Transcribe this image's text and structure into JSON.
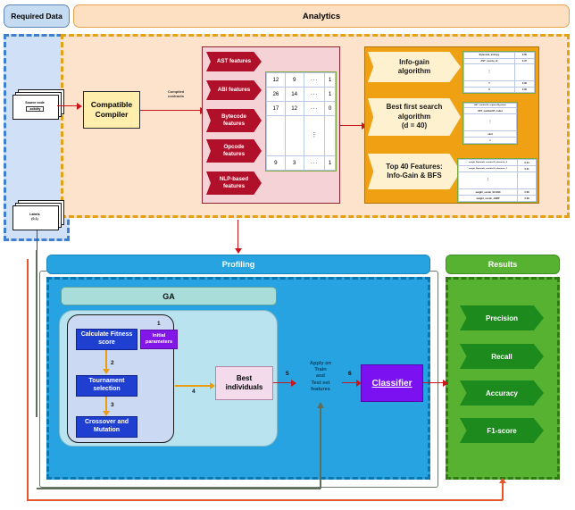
{
  "headers": {
    "required_data": "Required Data",
    "analytics": "Analytics",
    "profiling": "Profiling",
    "results": "Results",
    "ga": "GA"
  },
  "required_data": {
    "source_doc": {
      "title": "Source code",
      "sub": ".solidity"
    },
    "labels_doc": {
      "title": "Labels",
      "sub": "(0,1)"
    }
  },
  "analytics": {
    "compiler": "Compatible\nCompiler",
    "compiler_line1": "Compatible",
    "compiler_line2": "Compiler",
    "edge_compiled_contracts_l1": "Compiled",
    "edge_compiled_contracts_l2": "contracts",
    "features": [
      {
        "label": "AST features"
      },
      {
        "label": "ABI features"
      },
      {
        "label": "Bytecode features",
        "l1": "Bytecode",
        "l2": "features"
      },
      {
        "label": "Opcode features",
        "l1": "Opcode",
        "l2": "features"
      },
      {
        "label": "NLP-based features",
        "l1": "NLP-based",
        "l2": "features"
      }
    ],
    "feature_table": {
      "rows": [
        [
          "12",
          "9",
          "···",
          "1"
        ],
        [
          "26",
          "14",
          "···",
          "1"
        ],
        [
          "17",
          "12",
          "···",
          "0"
        ],
        [
          "",
          "",
          "⋮",
          ""
        ],
        [
          "9",
          "3",
          "···",
          "1"
        ]
      ]
    },
    "selection": {
      "infogain": {
        "l1": "Info-gain",
        "l2": "algorithm"
      },
      "bfs": {
        "l1": "Best first search",
        "l2": "algorithm",
        "l3": "(d = 40)"
      },
      "top40": {
        "l1": "Top 40 Features:",
        "l2": "Info-Gain & BFS"
      },
      "infogain_table": {
        "rows": [
          [
            "Bytecode_entropy",
            "0.55"
          ],
          [
            "AST_source_id",
            "0.37"
          ],
          [
            "⋮",
            ""
          ],
          [
            "Y",
            "0.00"
          ],
          [
            "X",
            "0.00"
          ]
        ]
      },
      "bfs_table": {
        "rows": [
          [
            "AST_numberOf_exportedSymbols"
          ],
          [
            "AST_numberOf_nodes"
          ],
          [
            "⋮"
          ],
          [
            "stmt"
          ],
          [
            "x"
          ]
        ]
      },
      "top40_table": {
        "rows": [
          [
            "weight_Bytecode_numberOf_character_0",
            "0.34"
          ],
          [
            "weight_Bytecode_numberOf_character_1",
            "0.31"
          ],
          [
            "⋮",
            ""
          ],
          [
            "weight_ocode_SLOAD",
            "0.38"
          ],
          [
            "weight_ocode_JUMP",
            "0.38"
          ]
        ]
      }
    }
  },
  "profiling": {
    "ga_steps": [
      {
        "label": "Calculate Fitness score",
        "l1": "Calculate Fitness",
        "l2": "score"
      },
      {
        "label": "Tournament selection",
        "l1": "Tournament",
        "l2": "selection"
      },
      {
        "label": "Crossover and Mutation",
        "l1": "Crossover and",
        "l2": "Mutation"
      }
    ],
    "initial_parameters": {
      "l1": "Initial",
      "l2": "parameters"
    },
    "best_individuals": {
      "l1": "Best",
      "l2": "individuals"
    },
    "apply_label": {
      "l1": "Apply on",
      "l2": "Train",
      "l3": "and",
      "l4": "Test set",
      "l5": "features"
    },
    "classifier": "Classifier",
    "step_numbers": [
      "1",
      "2",
      "3",
      "4",
      "5",
      "6"
    ]
  },
  "results": {
    "metrics": [
      {
        "label": "Precision"
      },
      {
        "label": "Recall"
      },
      {
        "label": "Accuracy"
      },
      {
        "label": "F1-score"
      }
    ]
  },
  "colors": {
    "required_data_bg": "#cfe0f7",
    "required_data_border": "#3f7fd0",
    "analytics_bg": "#fde3cb",
    "analytics_border": "#e3a215",
    "profiling_bg": "#26a3e0",
    "profiling_border": "#0b76ae",
    "results_bg": "#57b231",
    "results_border": "#2f7a14",
    "feature_chevron": "#b01029",
    "selection_bg": "#efa113",
    "classifier": "#7b10f0",
    "ga_box": "#1f3fd1",
    "arrow_red": "#c9151b",
    "arrow_orange": "#eb9d12",
    "feedback": "#e8552a"
  }
}
